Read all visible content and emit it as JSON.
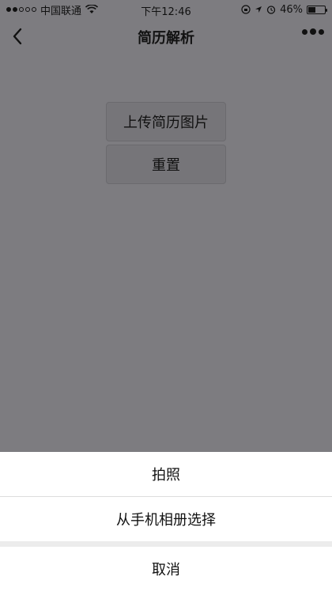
{
  "status_bar": {
    "carrier": "中国联通",
    "time": "下午12:46",
    "battery": "46%",
    "battery_level": 0.46,
    "icons": [
      "signal-dots",
      "wifi-icon",
      "orientation-lock-icon",
      "location-icon",
      "alarm-icon",
      "battery-icon"
    ]
  },
  "nav": {
    "title": "简历解析",
    "icons": [
      "back-chevron-icon",
      "more-dots-icon"
    ]
  },
  "main": {
    "upload_label": "上传简历图片",
    "reset_label": "重置"
  },
  "action_sheet": {
    "take_photo": "拍照",
    "choose_album": "从手机相册选择",
    "cancel": "取消"
  },
  "colors": {
    "overlay_background": "#7d7c80",
    "sheet_background": "#ffffff",
    "text": "#111111"
  }
}
